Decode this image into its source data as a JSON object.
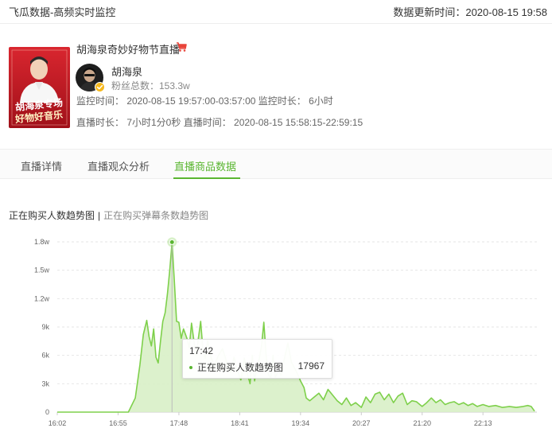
{
  "header": {
    "title": "飞瓜数据-高频实时监控",
    "updated": "数据更新时间：2020-08-15 19:58"
  },
  "live": {
    "title": "胡海泉奇妙好物节直播",
    "cover_text_line1": "胡海泉专场",
    "cover_text_line2": "好物好音乐",
    "anchor_name": "胡海泉",
    "fans": "粉丝总数：153.3w",
    "monitor_line": "监控时间： 2020-08-15 19:57:00-03:57:00 监控时长： 6小时",
    "live_line": "直播时长： 7小时1分0秒 直播时间： 2020-08-15 15:58:15-22:59:15"
  },
  "tabs": [
    {
      "label": "直播详情"
    },
    {
      "label": "直播观众分析"
    },
    {
      "label": "直播商品数据"
    }
  ],
  "active_tab": "直播商品数据",
  "chart_switch": {
    "active": "正在购买人数趋势图",
    "separator": "|",
    "inactive": "正在购买弹幕条数趋势图"
  },
  "tooltip": {
    "time": "17:42",
    "series": "正在购买人数趋势图",
    "value": "17967"
  },
  "colors": {
    "accent": "#5ab631",
    "line": "#7ed04b",
    "area": "#d8f0c6",
    "cart": "#e8443a"
  },
  "chart_data": {
    "type": "area",
    "title": "",
    "xlabel": "",
    "ylabel": "",
    "series_name": "正在购买人数趋势图",
    "xlim": [
      "16:02",
      "23:00"
    ],
    "ylim": [
      0,
      18000
    ],
    "y_ticks": [
      {
        "label": "0",
        "value": 0
      },
      {
        "label": "3k",
        "value": 3000
      },
      {
        "label": "6k",
        "value": 6000
      },
      {
        "label": "9k",
        "value": 9000
      },
      {
        "label": "1.2w",
        "value": 12000
      },
      {
        "label": "1.5w",
        "value": 15000
      },
      {
        "label": "1.8w",
        "value": 18000
      }
    ],
    "x_ticks": [
      "16:02",
      "16:55",
      "17:48",
      "18:41",
      "19:34",
      "20:27",
      "21:20",
      "22:13"
    ],
    "grid": true,
    "legend": "none",
    "highlight": {
      "time": "17:42",
      "value": 17967
    },
    "points": [
      [
        "16:02",
        0
      ],
      [
        "16:30",
        0
      ],
      [
        "16:50",
        0
      ],
      [
        "17:04",
        0
      ],
      [
        "17:10",
        1500
      ],
      [
        "17:14",
        5000
      ],
      [
        "17:17",
        8200
      ],
      [
        "17:20",
        9700
      ],
      [
        "17:22",
        8000
      ],
      [
        "17:24",
        7000
      ],
      [
        "17:26",
        8800
      ],
      [
        "17:28",
        5800
      ],
      [
        "17:30",
        5200
      ],
      [
        "17:32",
        7500
      ],
      [
        "17:34",
        9600
      ],
      [
        "17:36",
        10500
      ],
      [
        "17:38",
        12500
      ],
      [
        "17:40",
        15000
      ],
      [
        "17:42",
        17967
      ],
      [
        "17:44",
        14000
      ],
      [
        "17:46",
        9600
      ],
      [
        "17:48",
        9500
      ],
      [
        "17:50",
        7800
      ],
      [
        "17:52",
        8800
      ],
      [
        "17:55",
        7800
      ],
      [
        "17:57",
        6800
      ],
      [
        "17:59",
        9400
      ],
      [
        "18:01",
        7600
      ],
      [
        "18:03",
        6000
      ],
      [
        "18:05",
        7800
      ],
      [
        "18:07",
        9600
      ],
      [
        "18:09",
        6500
      ],
      [
        "18:11",
        5700
      ],
      [
        "18:13",
        7600
      ],
      [
        "18:16",
        5800
      ],
      [
        "18:19",
        4900
      ],
      [
        "18:22",
        5900
      ],
      [
        "18:26",
        6700
      ],
      [
        "18:30",
        5200
      ],
      [
        "18:33",
        4200
      ],
      [
        "18:36",
        5800
      ],
      [
        "18:39",
        4400
      ],
      [
        "18:42",
        3400
      ],
      [
        "18:45",
        5700
      ],
      [
        "18:48",
        3900
      ],
      [
        "18:50",
        3000
      ],
      [
        "18:52",
        6000
      ],
      [
        "18:54",
        3300
      ],
      [
        "18:56",
        4800
      ],
      [
        "18:58",
        5600
      ],
      [
        "19:00",
        7000
      ],
      [
        "19:02",
        9500
      ],
      [
        "19:04",
        6000
      ],
      [
        "19:06",
        4000
      ],
      [
        "19:08",
        3600
      ],
      [
        "19:10",
        6000
      ],
      [
        "19:12",
        3700
      ],
      [
        "19:15",
        4400
      ],
      [
        "19:17",
        3900
      ],
      [
        "19:20",
        5700
      ],
      [
        "19:23",
        7300
      ],
      [
        "19:26",
        5300
      ],
      [
        "19:29",
        4600
      ],
      [
        "19:32",
        3900
      ],
      [
        "19:34",
        3300
      ],
      [
        "19:37",
        2600
      ],
      [
        "19:39",
        1500
      ],
      [
        "19:42",
        1200
      ],
      [
        "19:46",
        1600
      ],
      [
        "19:50",
        2000
      ],
      [
        "19:54",
        1300
      ],
      [
        "19:58",
        2400
      ],
      [
        "20:02",
        1800
      ],
      [
        "20:06",
        1200
      ],
      [
        "20:10",
        800
      ],
      [
        "20:14",
        1500
      ],
      [
        "20:18",
        700
      ],
      [
        "20:22",
        1000
      ],
      [
        "20:27",
        500
      ],
      [
        "20:31",
        1600
      ],
      [
        "20:35",
        1000
      ],
      [
        "20:39",
        1900
      ],
      [
        "20:43",
        2100
      ],
      [
        "20:47",
        1300
      ],
      [
        "20:51",
        1900
      ],
      [
        "20:55",
        1000
      ],
      [
        "20:59",
        1700
      ],
      [
        "21:03",
        2000
      ],
      [
        "21:07",
        800
      ],
      [
        "21:11",
        1200
      ],
      [
        "21:15",
        1100
      ],
      [
        "21:20",
        600
      ],
      [
        "21:24",
        1000
      ],
      [
        "21:28",
        1500
      ],
      [
        "21:32",
        1000
      ],
      [
        "21:36",
        1300
      ],
      [
        "21:40",
        800
      ],
      [
        "21:44",
        1000
      ],
      [
        "21:48",
        1100
      ],
      [
        "21:52",
        800
      ],
      [
        "21:56",
        1000
      ],
      [
        "22:00",
        700
      ],
      [
        "22:04",
        900
      ],
      [
        "22:08",
        600
      ],
      [
        "22:13",
        800
      ],
      [
        "22:18",
        600
      ],
      [
        "22:24",
        700
      ],
      [
        "22:30",
        500
      ],
      [
        "22:36",
        600
      ],
      [
        "22:42",
        500
      ],
      [
        "22:48",
        600
      ],
      [
        "22:52",
        700
      ],
      [
        "22:55",
        600
      ],
      [
        "22:58",
        100
      ]
    ]
  }
}
